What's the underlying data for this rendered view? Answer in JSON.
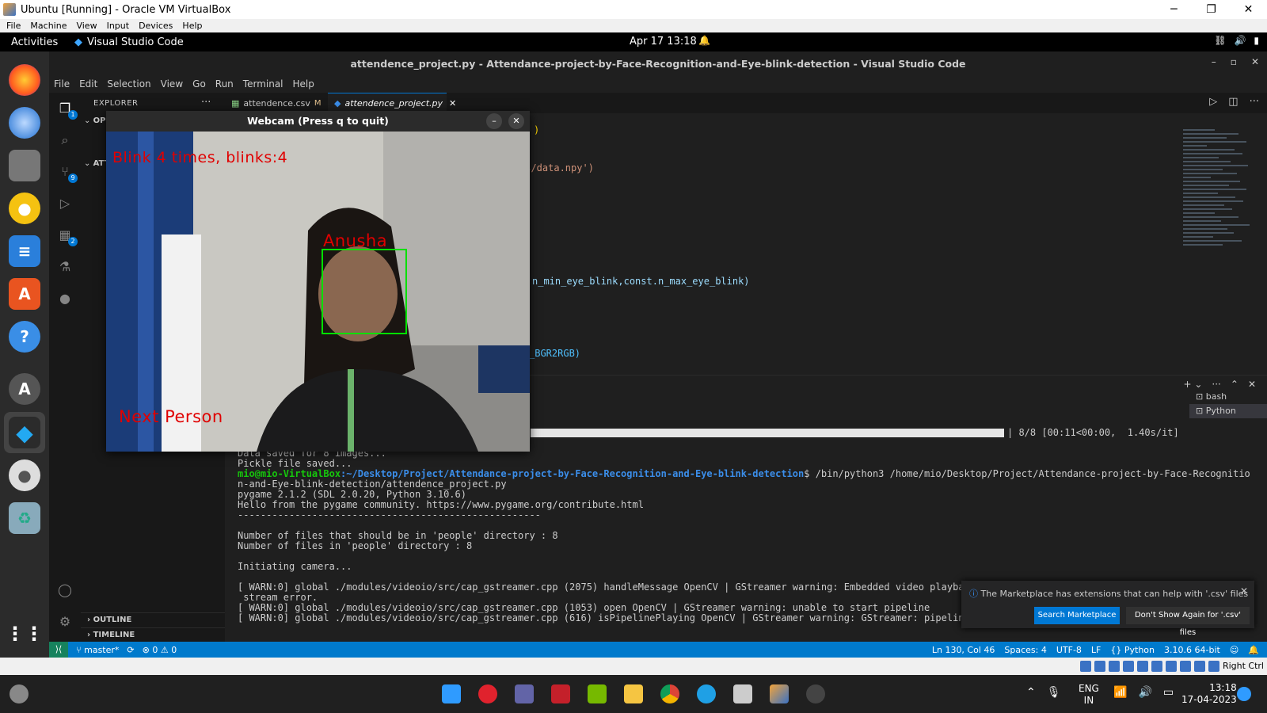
{
  "host": {
    "window_title": "Ubuntu [Running] - Oracle VM VirtualBox",
    "menu": [
      "File",
      "Machine",
      "View",
      "Input",
      "Devices",
      "Help"
    ],
    "right_ctrl": "Right Ctrl"
  },
  "ubuntu": {
    "activities": "Activities",
    "app": "Visual Studio Code",
    "clock": "Apr 17  13:18"
  },
  "vscode": {
    "title": "attendence_project.py - Attendance-project-by-Face-Recognition-and-Eye-blink-detection - Visual Studio Code",
    "menu": [
      "File",
      "Edit",
      "Selection",
      "View",
      "Go",
      "Run",
      "Terminal",
      "Help"
    ],
    "explorer_title": "EXPLORER",
    "open_editors": "OPE",
    "project_section": "ATTE",
    "outline": "OUTLINE",
    "timeline": "TIMELINE",
    "tabs": [
      {
        "name": "attendence.csv",
        "badge": "M"
      },
      {
        "name": "attendence_project.py"
      }
    ],
    "code_fragments": [
      ")",
      "gs/data.npy')",
      "n_min_eye_blink,const.n_max_eye_blink)",
      "_BGR2RGB)"
    ],
    "terminal_progress": "| 8/8 [00:11<00:00,  1.40s/it]",
    "terminal_lines": [
      "Data saved for 8 images...",
      "Pickle file saved..."
    ],
    "prompt_user": "mio@mio-VirtualBox",
    "prompt_path": ":~/Desktop/Project/Attendance-project-by-Face-Recognition-and-Eye-blink-detection",
    "prompt_cmd": "$ /bin/python3 /home/mio/Desktop/Project/Attendance-project-by-Face-Recognitio",
    "output_lines": [
      "n-and-Eye-blink-detection/attendence_project.py",
      "pygame 2.1.2 (SDL 2.0.20, Python 3.10.6)",
      "Hello from the pygame community. https://www.pygame.org/contribute.html",
      "-----------------------------------------------------",
      "",
      "Number of files that should be in 'people' directory : 8",
      "Number of files in 'people' directory : 8",
      "",
      "Initiating camera...",
      "",
      "[ WARN:0] global ./modules/videoio/src/cap_gstreamer.cpp (2075) handleMessage OpenCV | GStreamer warning: Embedded video playback halted;",
      " stream error.",
      "[ WARN:0] global ./modules/videoio/src/cap_gstreamer.cpp (1053) open OpenCV | GStreamer warning: unable to start pipeline",
      "[ WARN:0] global ./modules/videoio/src/cap_gstreamer.cpp (616) isPipelinePlaying OpenCV | GStreamer warning: GStreamer: pipeline have not"
    ],
    "terminals": [
      "bash",
      "Python"
    ],
    "notification": {
      "message": "The Marketplace has extensions that can help with '.csv' files",
      "primary": "Search Marketplace",
      "secondary": "Don't Show Again for '.csv' files"
    },
    "status": {
      "branch": "master*",
      "problems": "0 ⚠ 0",
      "right": [
        "Ln 130, Col 46",
        "Spaces: 4",
        "UTF-8",
        "LF",
        "{} Python",
        "3.10.6 64-bit"
      ]
    }
  },
  "webcam": {
    "title": "Webcam (Press q to quit)",
    "blink_text": "Blink 4 times, blinks:4",
    "person_name": "Anusha",
    "next_text": "Next Person"
  },
  "taskbar": {
    "lang_1": "ENG",
    "lang_2": "IN",
    "time": "13:18",
    "date": "17-04-2023"
  },
  "colors": {
    "accent": "#0078d4",
    "statusbar": "#007acc",
    "overlay_text": "#e00000",
    "face_box": "#00e000"
  }
}
